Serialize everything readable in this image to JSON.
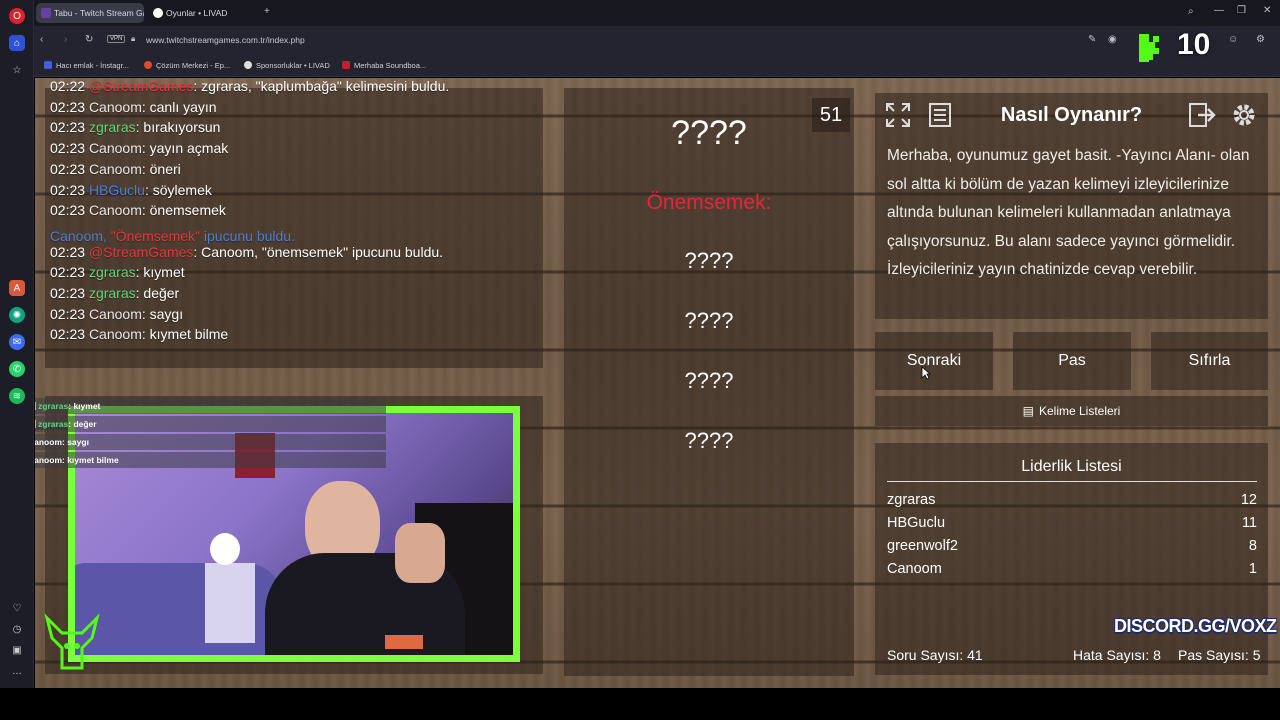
{
  "browser": {
    "tabs": [
      {
        "label": "Tabu - Twitch Stream Gam",
        "active": true
      },
      {
        "label": "Oyunlar • LIVAD",
        "active": false
      }
    ],
    "new_tab_icon": "plus-icon",
    "url": "www.twitchstreamgames.com.tr/index.php",
    "vpn_label": "VPN",
    "bookmarks": [
      "Hacı emlak - İnstagr...",
      "Çözüm Merkezi - Ep...",
      "Sponsorluklar • LIVAD",
      "Merhaba Soundboa..."
    ]
  },
  "chat": {
    "lines": [
      {
        "time": "02:22",
        "name": "@StreamGames",
        "name_color": "red",
        "msg": ": zgraras, \"kaplumbağa\" kelimesini buldu."
      },
      {
        "time": "02:23",
        "name": "Canoom",
        "name_color": "white",
        "msg": ": canlı yayın"
      },
      {
        "time": "02:23",
        "name": "zgraras",
        "name_color": "green",
        "msg": ": bırakıyorsun"
      },
      {
        "time": "02:23",
        "name": "Canoom",
        "name_color": "white",
        "msg": ": yayın açmak"
      },
      {
        "time": "02:23",
        "name": "Canoom",
        "name_color": "white",
        "msg": ": öneri"
      },
      {
        "time": "02:23",
        "name": "HBGuclu",
        "name_color": "blue",
        "msg": ": söylemek"
      },
      {
        "time": "02:23",
        "name": "Canoom",
        "name_color": "white",
        "msg": ": önemsemek"
      },
      {
        "time": "",
        "name": "",
        "name_color": "",
        "msg": ""
      },
      {
        "time": "02:23",
        "name": "@StreamGames",
        "name_color": "red",
        "msg": ": Canoom, \"önemsemek\" ipucunu buldu."
      },
      {
        "time": "02:23",
        "name": "zgraras",
        "name_color": "green",
        "msg": ": kıymet"
      },
      {
        "time": "02:23",
        "name": "zgraras",
        "name_color": "green",
        "msg": ": değer"
      },
      {
        "time": "02:23",
        "name": "Canoom",
        "name_color": "white",
        "msg": ": saygı"
      },
      {
        "time": "02:23",
        "name": "Canoom",
        "name_color": "white",
        "msg": ": kıymet bilme"
      }
    ],
    "hint_notice": {
      "name": "Canoom,",
      "word": "\"Önemsemek\"",
      "rest": " ipucunu buldu."
    }
  },
  "cam_chat": [
    {
      "name": "zgraras",
      "msg": ": kıymet"
    },
    {
      "name": "zgraras",
      "msg": ": değer"
    },
    {
      "name": "Canoom",
      "msg": ": saygı"
    },
    {
      "name": "Canoom",
      "msg": ": kıymet bilme"
    }
  ],
  "game": {
    "timer": "51",
    "main_word": "????",
    "found_hint": "Önemsemek:",
    "hidden_words": [
      "????",
      "????",
      "????",
      "????"
    ]
  },
  "how_to": {
    "title": "Nasıl Oynanır?",
    "text": "Merhaba, oyunumuz gayet basit. -Yayıncı Alanı- olan sol altta ki bölüm de yazan kelimeyi izleyicilerinize altında bulunan kelimeleri kullanmadan anlatmaya çalışıyorsunuz. Bu alanı sadece yayıncı görmelidir. İzleyicileriniz yayın chatinizde cevap verebilir."
  },
  "buttons": {
    "next": "Sonraki",
    "pass": "Pas",
    "reset": "Sıfırla",
    "word_lists": "Kelime Listeleri"
  },
  "leaderboard": {
    "title": "Liderlik Listesi",
    "rows": [
      {
        "name": "zgraras",
        "score": "12"
      },
      {
        "name": "HBGuclu",
        "score": "11"
      },
      {
        "name": "greenwolf2",
        "score": "8"
      },
      {
        "name": "Canoom",
        "score": "1"
      }
    ]
  },
  "stats": {
    "questions": "Soru Sayısı: 41",
    "errors": "Hata Sayısı: 8",
    "passes": "Pas Sayısı: 5"
  },
  "overlay": {
    "discord": "DISCORD.GG/VOXZ",
    "kick_count": "10"
  },
  "colors": {
    "accent_green": "#7cff3d",
    "hint_red": "#e0283a",
    "name_green": "#5fd67a",
    "name_blue": "#4a7ed8"
  }
}
